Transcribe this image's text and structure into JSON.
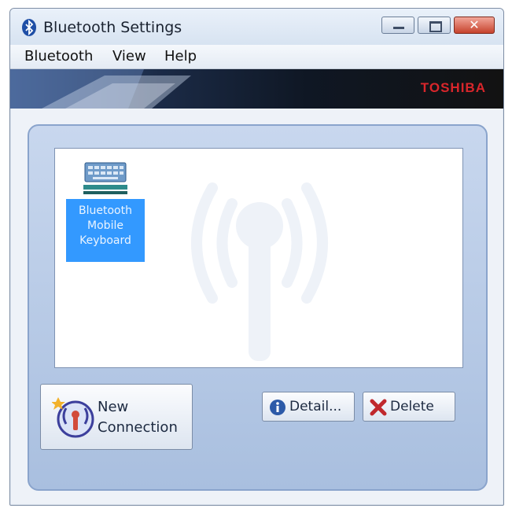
{
  "window": {
    "title": "Bluetooth Settings",
    "close_glyph": "✕"
  },
  "menu": {
    "items": [
      "Bluetooth",
      "View",
      "Help"
    ]
  },
  "banner": {
    "brand": "TOSHIBA"
  },
  "devices": [
    {
      "name": "Bluetooth\nMobile\nKeyboard",
      "icon": "keyboard-icon",
      "selected": true
    }
  ],
  "buttons": {
    "new_connection": "New\nConnection",
    "detail": "Detail...",
    "delete": "Delete"
  },
  "colors": {
    "selection": "#3399ff",
    "brand_red": "#d9262b",
    "panel": "#c8d7ee"
  }
}
